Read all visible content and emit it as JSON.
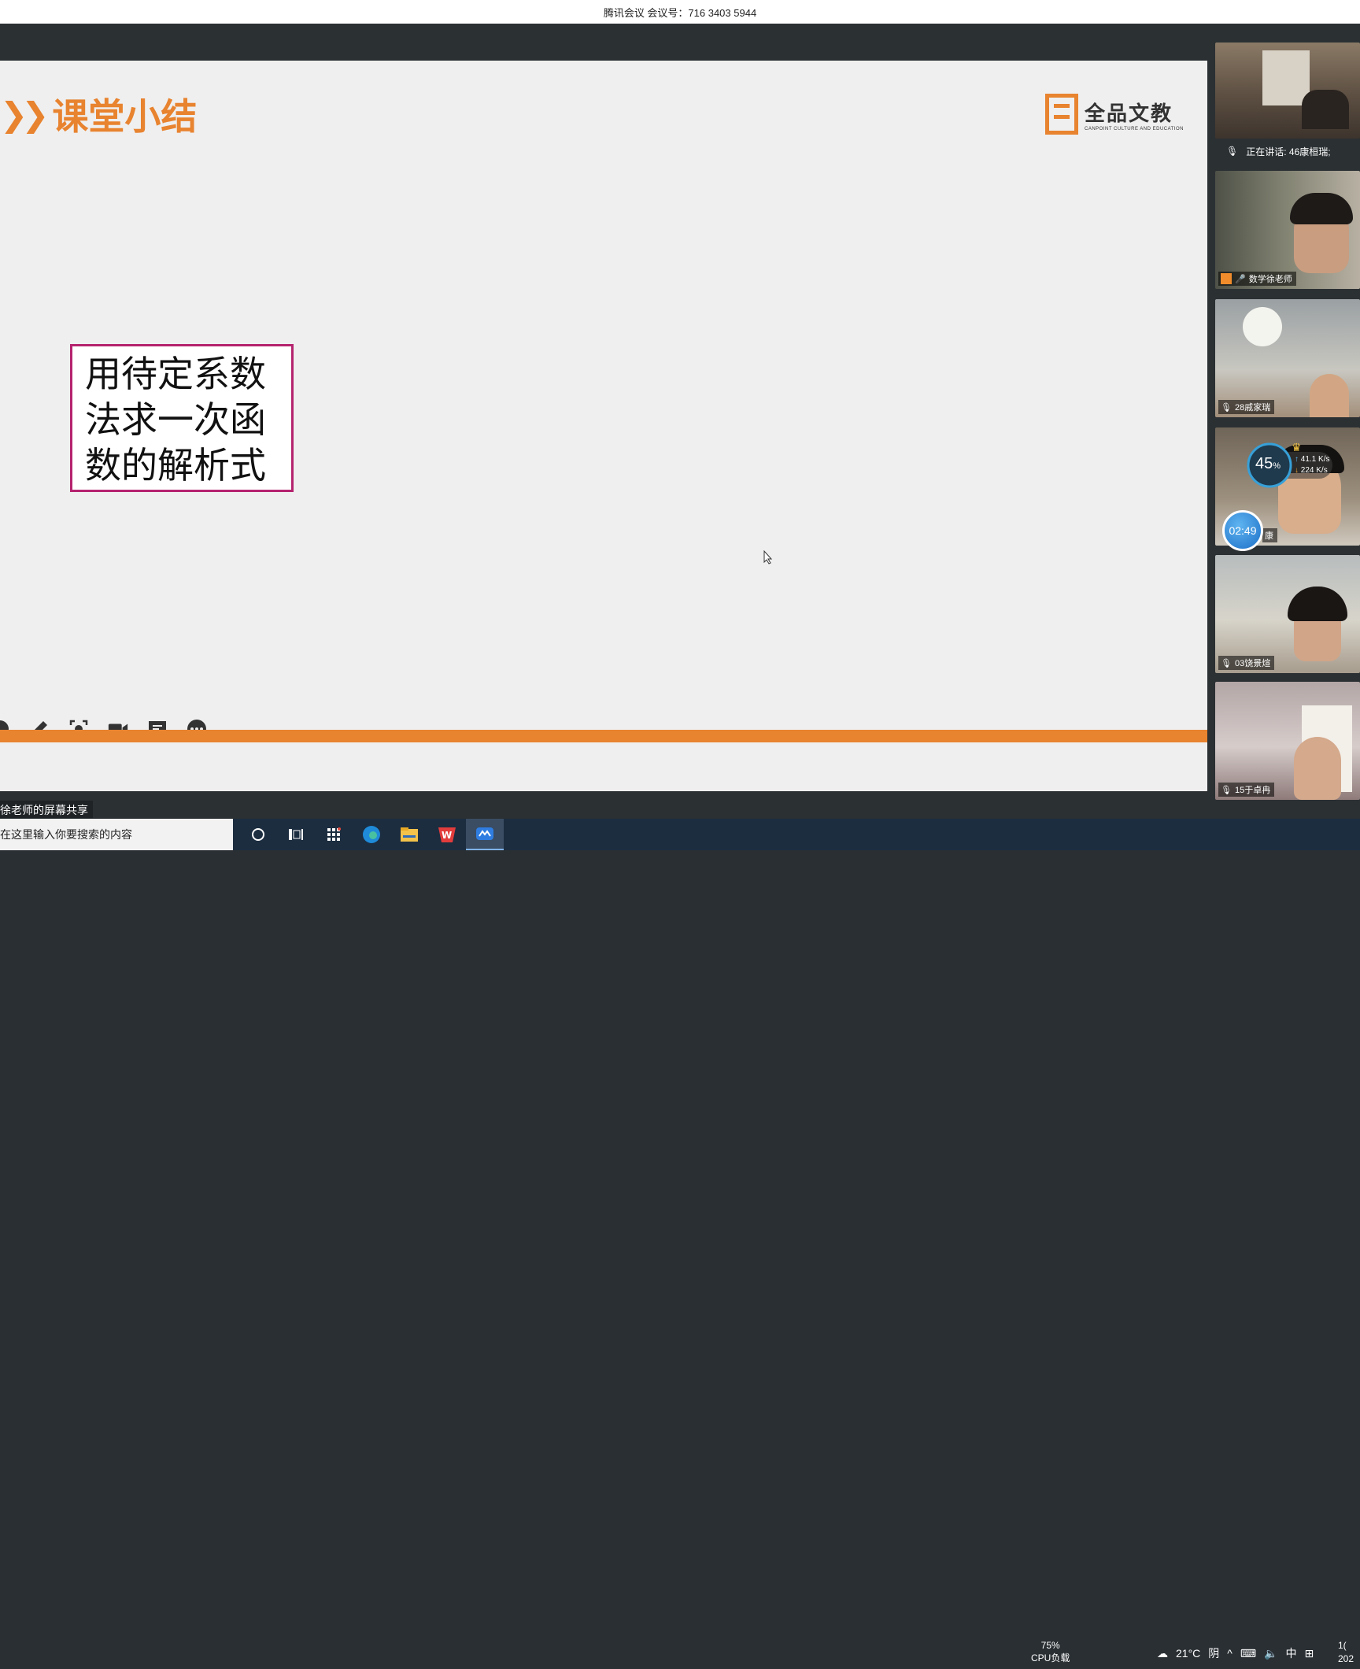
{
  "window": {
    "title": "腾讯会议 会议号：716 3403 5944"
  },
  "slide": {
    "title": "课堂小结",
    "logo_cn": "全品文教",
    "logo_en": "CANPOINT CULTURE AND EDUCATION",
    "box_lines": [
      "用待定系数",
      "法求一次函",
      "数的解析式"
    ]
  },
  "share_label": "徐老师的屏幕共享",
  "participants": {
    "speaking": "正在讲话: 46康桓瑞;",
    "tiles": [
      {
        "name": "数学徐老师"
      },
      {
        "name": "28戚家瑞"
      },
      {
        "name": "康"
      },
      {
        "name": "03饶景煊"
      },
      {
        "name": "15于卓冉"
      }
    ]
  },
  "net_monitor": {
    "percent": "45",
    "percent_unit": "%",
    "upload": "41.1",
    "upload_unit": "K/s",
    "download": "224",
    "download_unit": "K/s"
  },
  "timer": "02:49",
  "taskbar": {
    "search_placeholder": "在这里输入你要搜索的内容",
    "cpu_percent": "75%",
    "cpu_label": "CPU负载",
    "weather": "21°C",
    "weather_desc": "阴",
    "ime": "中",
    "time": "1(",
    "date": "202"
  }
}
